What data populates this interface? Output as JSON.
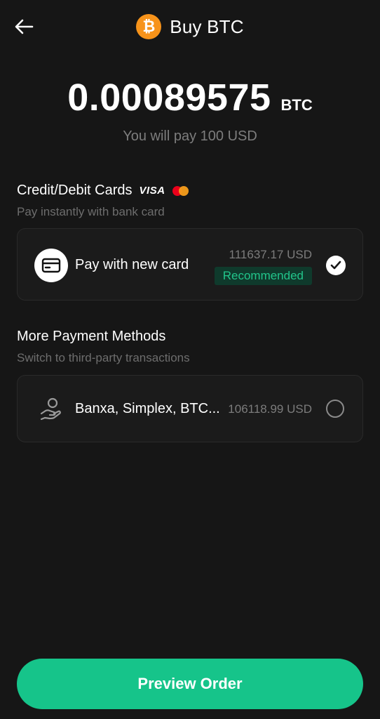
{
  "header": {
    "title": "Buy BTC",
    "back_icon": "arrow-left-icon",
    "coin_icon": "bitcoin-icon",
    "coin_symbol": "₿"
  },
  "summary": {
    "amount": "0.00089575",
    "unit": "BTC",
    "pay_note": "You will pay 100 USD"
  },
  "cards_section": {
    "title": "Credit/Debit Cards",
    "visa_label": "VISA",
    "subtitle": "Pay instantly with bank card",
    "option": {
      "label": "Pay with new card",
      "price": "111637.17 USD",
      "badge": "Recommended",
      "selected": true
    }
  },
  "more_section": {
    "title": "More Payment Methods",
    "subtitle": "Switch to third-party transactions",
    "option": {
      "label": "Banxa, Simplex, BTC...",
      "price": "106118.99 USD",
      "selected": false
    }
  },
  "footer": {
    "button_label": "Preview Order"
  },
  "colors": {
    "background": "#161616",
    "accent": "#16c48a",
    "badge_text": "#22c58b",
    "bitcoin": "#f7931a"
  }
}
